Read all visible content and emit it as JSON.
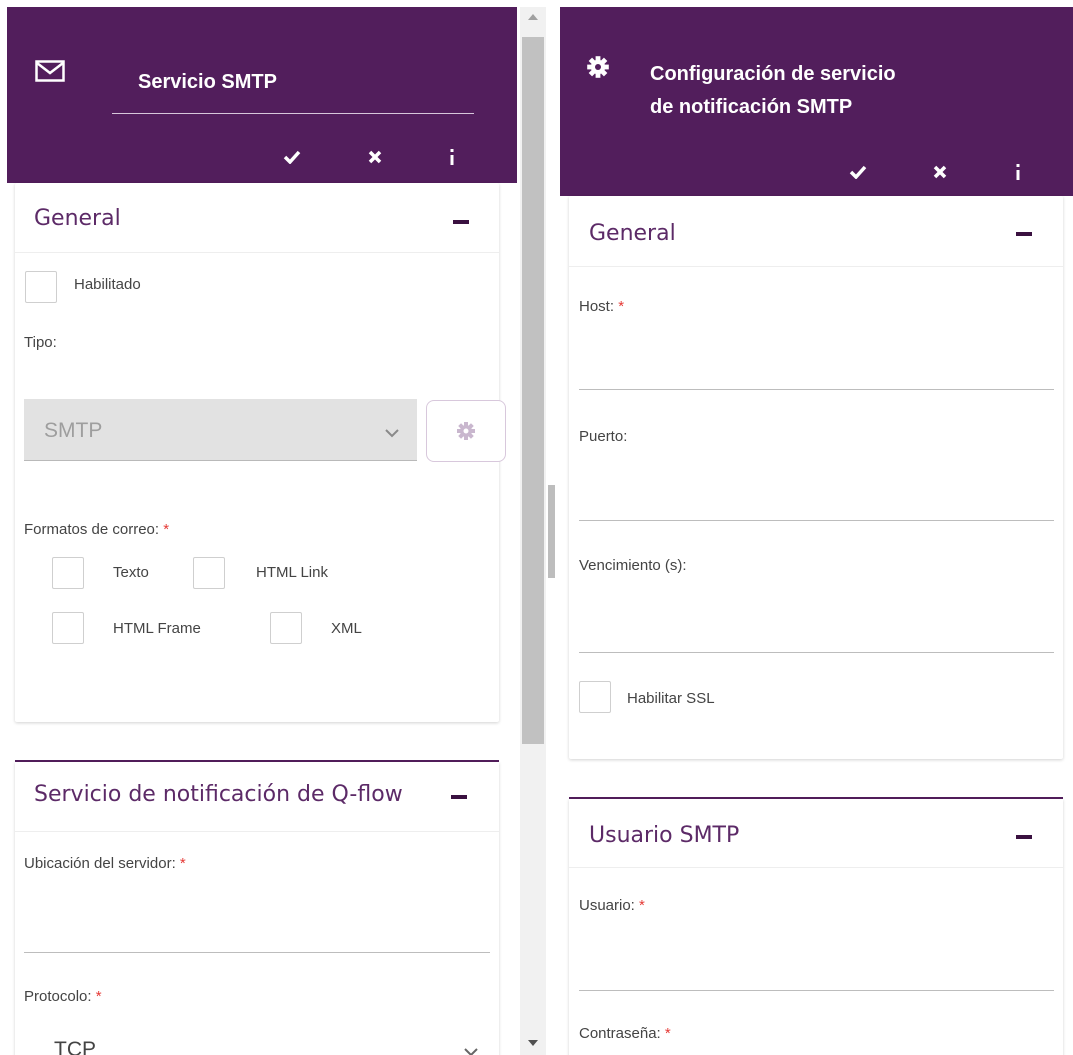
{
  "left_panel": {
    "header": {
      "title": "Servicio SMTP",
      "icon": "envelope-icon",
      "actions": [
        "check-icon",
        "close-icon",
        "more-vertical-icon"
      ]
    },
    "general": {
      "title": "General",
      "habilitado_label": "Habilitado",
      "tipo_label": "Tipo:",
      "tipo_value": "SMTP",
      "formatos_label": "Formatos de correo:",
      "formatos": [
        "Texto",
        "HTML Link",
        "HTML Frame",
        "XML"
      ]
    },
    "qflow": {
      "title": "Servicio de notificación de Q-flow",
      "ubicacion_label": "Ubicación del servidor:",
      "protocolo_label": "Protocolo:",
      "protocolo_value": "TCP"
    }
  },
  "right_panel": {
    "header": {
      "title_line1": "Configuración de servicio",
      "title_line2": "de notificación SMTP",
      "icon": "gear-icon",
      "actions": [
        "check-icon",
        "close-icon",
        "more-vertical-icon"
      ]
    },
    "general": {
      "title": "General",
      "host_label": "Host:",
      "puerto_label": "Puerto:",
      "vencimiento_label": "Vencimiento (s):",
      "ssl_label": "Habilitar SSL"
    },
    "usuario": {
      "title": "Usuario SMTP",
      "usuario_label": "Usuario:",
      "contrasena_label": "Contraseña:"
    }
  },
  "required_mark": "*",
  "colors": {
    "header": "#521e5c",
    "section_title": "#5c2a67",
    "required": "#e53935"
  }
}
